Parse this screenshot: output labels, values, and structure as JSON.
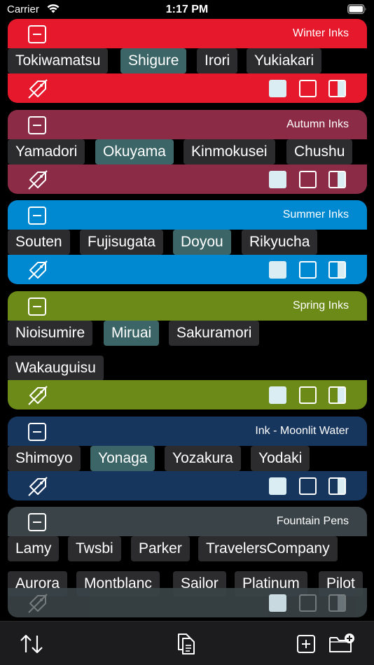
{
  "status_bar": {
    "carrier": "Carrier",
    "time": "1:17 PM"
  },
  "groups": [
    {
      "title": "Winter Inks",
      "color": "#e5182c",
      "tags": [
        {
          "label": "Tokiwamatsu",
          "selected": false
        },
        {
          "label": "Shigure",
          "selected": true
        },
        {
          "label": "Irori",
          "selected": false
        },
        {
          "label": "Yukiakari",
          "selected": false
        }
      ]
    },
    {
      "title": "Autumn Inks",
      "color": "#8b2b46",
      "tags": [
        {
          "label": "Yamadori",
          "selected": false
        },
        {
          "label": "Okuyama",
          "selected": true
        },
        {
          "label": "Kinmokusei",
          "selected": false
        },
        {
          "label": "Chushu",
          "selected": false
        }
      ]
    },
    {
      "title": "Summer Inks",
      "color": "#0088d1",
      "tags": [
        {
          "label": "Souten",
          "selected": false
        },
        {
          "label": "Fujisugata",
          "selected": false
        },
        {
          "label": "Doyou",
          "selected": true
        },
        {
          "label": "Rikyucha",
          "selected": false
        }
      ]
    },
    {
      "title": "Spring Inks",
      "color": "#6b8a18",
      "tags": [
        {
          "label": "Nioisumire",
          "selected": false
        },
        {
          "label": "Miruai",
          "selected": true
        },
        {
          "label": "Sakuramori",
          "selected": false
        },
        {
          "label": "Wakauguisu",
          "selected": false
        }
      ]
    },
    {
      "title": "Ink - Moonlit Water",
      "color": "#17365e",
      "tags": [
        {
          "label": "Shimoyo",
          "selected": false
        },
        {
          "label": "Yonaga",
          "selected": true
        },
        {
          "label": "Yozakura",
          "selected": false
        },
        {
          "label": "Yodaki",
          "selected": false
        }
      ]
    },
    {
      "title": "Fountain Pens",
      "color": "#3a4347",
      "tags": [
        {
          "label": "Lamy",
          "selected": false
        },
        {
          "label": "Twsbi",
          "selected": false
        },
        {
          "label": "Parker",
          "selected": false
        },
        {
          "label": "TravelersCompany",
          "selected": false
        },
        {
          "label": "Aurora",
          "selected": false
        },
        {
          "label": "Montblanc",
          "selected": false
        },
        {
          "label": "Sailor",
          "selected": false
        },
        {
          "label": "Platinum",
          "selected": false
        },
        {
          "label": "Pilot",
          "selected": false
        }
      ]
    }
  ],
  "icons": {
    "collapse": "minus-square-icon",
    "tag_off": "tag-slash-icon",
    "select_all": "filled-square-icon",
    "select_none": "empty-square-icon",
    "invert": "half-square-icon",
    "sort": "sort-arrows-icon",
    "copy": "copy-documents-icon",
    "add": "plus-square-icon",
    "add_folder": "folder-plus-icon"
  }
}
